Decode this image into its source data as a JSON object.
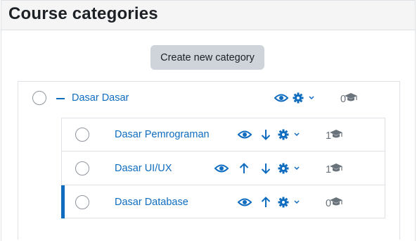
{
  "page": {
    "title": "Course categories"
  },
  "actions": {
    "create_category_label": "Create new category"
  },
  "categories": [
    {
      "name": "Dasar Dasar",
      "course_count": "0",
      "expanded": true,
      "children": [
        {
          "name": "Dasar Pemrograman",
          "course_count": "1",
          "selected": false
        },
        {
          "name": "Dasar UI/UX",
          "course_count": "1",
          "selected": false
        },
        {
          "name": "Dasar Database",
          "course_count": "0",
          "selected": true
        }
      ]
    }
  ],
  "colors": {
    "link": "#0f6cbf",
    "muted": "#6a737b",
    "header_bg": "#f5f5f5",
    "button_bg": "#ced4da",
    "border": "#dee2e6"
  },
  "icons": {
    "visibility": "eye-icon",
    "move_up": "arrow-up-icon",
    "move_down": "arrow-down-icon",
    "settings": "gear-icon",
    "dropdown": "chevron-down-icon",
    "courses": "graduation-cap-icon",
    "collapse": "minus-icon"
  }
}
